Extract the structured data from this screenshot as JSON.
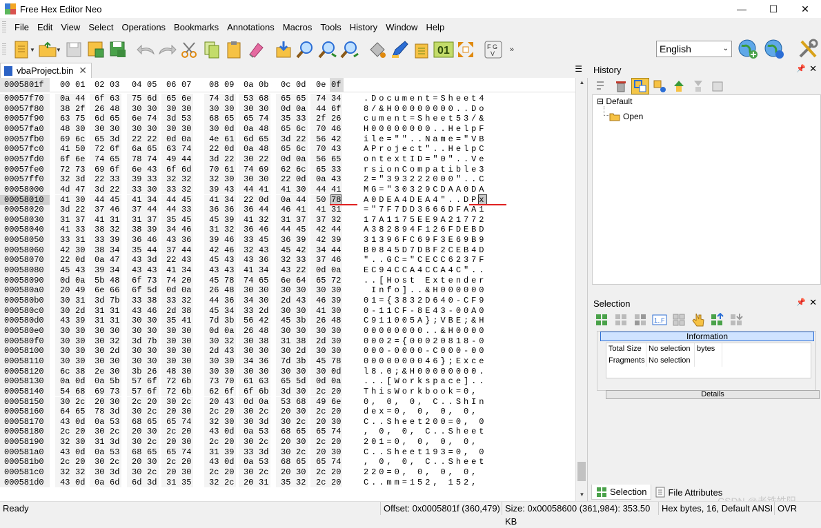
{
  "window": {
    "title": "Free Hex Editor Neo",
    "minimize": "—",
    "maximize": "☐",
    "close": "✕"
  },
  "menu": [
    "File",
    "Edit",
    "View",
    "Select",
    "Operations",
    "Bookmarks",
    "Annotations",
    "Macros",
    "Tools",
    "History",
    "Window",
    "Help"
  ],
  "toolbar": {
    "language": "English",
    "icons": [
      "new-file-icon",
      "open-folder-icon",
      "save-disk-icon",
      "save-as-icon",
      "save-all-icon",
      "undo-icon",
      "redo-icon",
      "cut-scissors-icon",
      "copy-icon",
      "paste-icon",
      "eraser-icon",
      "import-icon",
      "find-icon",
      "find-next-icon",
      "find-prev-icon",
      "fill-icon",
      "patch-icon",
      "annotate-icon",
      "binary-01-icon",
      "expand-icon",
      "fgv-icon",
      "globe-add-icon",
      "globe-icon",
      "settings-tools-icon"
    ]
  },
  "tab": {
    "label": "vbaProject.bin",
    "close": "✕",
    "menu_icon": "☰"
  },
  "hex": {
    "cursor_offset": "0005801f",
    "columns": [
      "00",
      "01",
      "02",
      "03",
      "04",
      "05",
      "06",
      "07",
      "08",
      "09",
      "0a",
      "0b",
      "0c",
      "0d",
      "0e",
      "0f"
    ],
    "rows": [
      {
        "off": "00057f70",
        "hex": "0a 44 6f 63 75 6d 65 6e 74 3d 53 68 65 65 74 34",
        "ascii": ".Document=Sheet4"
      },
      {
        "off": "00057f80",
        "hex": "38 2f 26 48 30 30 30 30 30 30 30 30 0d 0a 44 6f",
        "ascii": "8/&H00000000..Do"
      },
      {
        "off": "00057f90",
        "hex": "63 75 6d 65 6e 74 3d 53 68 65 65 74 35 33 2f 26",
        "ascii": "cument=Sheet53/&"
      },
      {
        "off": "00057fa0",
        "hex": "48 30 30 30 30 30 30 30 30 0d 0a 48 65 6c 70 46",
        "ascii": "H00000000..HelpF"
      },
      {
        "off": "00057fb0",
        "hex": "69 6c 65 3d 22 22 0d 0a 4e 61 6d 65 3d 22 56 42",
        "ascii": "ile=\"\"..Name=\"VB"
      },
      {
        "off": "00057fc0",
        "hex": "41 50 72 6f 6a 65 63 74 22 0d 0a 48 65 6c 70 43",
        "ascii": "AProject\"..HelpC"
      },
      {
        "off": "00057fd0",
        "hex": "6f 6e 74 65 78 74 49 44 3d 22 30 22 0d 0a 56 65",
        "ascii": "ontextID=\"0\"..Ve"
      },
      {
        "off": "00057fe0",
        "hex": "72 73 69 6f 6e 43 6f 6d 70 61 74 69 62 6c 65 33",
        "ascii": "rsionCompatible3"
      },
      {
        "off": "00057ff0",
        "hex": "32 3d 22 33 39 33 32 32 32 30 30 30 22 0d 0a 43",
        "ascii": "2=\"393222000\"..C"
      },
      {
        "off": "00058000",
        "hex": "4d 47 3d 22 33 30 33 32 39 43 44 41 41 30 44 41",
        "ascii": "MG=\"30329CDAA0DA"
      },
      {
        "off": "00058010",
        "hex": "41 30 44 45 41 34 44 45 41 34 22 0d 0a 44 50 78",
        "ascii": "A0DEA4DEA4\"..DPx"
      },
      {
        "off": "00058020",
        "hex": "3d 22 37 46 37 44 44 33 36 36 36 44 46 41 41 31",
        "ascii": "=\"7F7DD3666DFAA1"
      },
      {
        "off": "00058030",
        "hex": "31 37 41 31 31 37 35 45 45 39 41 32 31 37 37 32",
        "ascii": "17A1175EE9A21772"
      },
      {
        "off": "00058040",
        "hex": "41 33 38 32 38 39 34 46 31 32 36 46 44 45 42 44",
        "ascii": "A382894F126FDEBD"
      },
      {
        "off": "00058050",
        "hex": "33 31 33 39 36 46 43 36 39 46 33 45 36 39 42 39",
        "ascii": "31396FC69F3E69B9"
      },
      {
        "off": "00058060",
        "hex": "42 30 38 34 35 44 37 44 42 46 32 43 45 42 34 44",
        "ascii": "B0845D7DBF2CEB4D"
      },
      {
        "off": "00058070",
        "hex": "22 0d 0a 47 43 3d 22 43 45 43 43 36 32 33 37 46",
        "ascii": "\"..GC=\"CECC6237F"
      },
      {
        "off": "00058080",
        "hex": "45 43 39 34 43 43 41 34 43 43 41 34 43 22 0d 0a",
        "ascii": "EC94CCA4CCA4C\".."
      },
      {
        "off": "00058090",
        "hex": "0d 0a 5b 48 6f 73 74 20 45 78 74 65 6e 64 65 72",
        "ascii": "..[Host Extender"
      },
      {
        "off": "000580a0",
        "hex": "20 49 6e 66 6f 5d 0d 0a 26 48 30 30 30 30 30 30",
        "ascii": " Info]..&H000000"
      },
      {
        "off": "000580b0",
        "hex": "30 31 3d 7b 33 38 33 32 44 36 34 30 2d 43 46 39",
        "ascii": "01={3832D640-CF9"
      },
      {
        "off": "000580c0",
        "hex": "30 2d 31 31 43 46 2d 38 45 34 33 2d 30 30 41 30",
        "ascii": "0-11CF-8E43-00A0"
      },
      {
        "off": "000580d0",
        "hex": "43 39 31 31 30 30 35 41 7d 3b 56 42 45 3b 26 48",
        "ascii": "C911005A};VBE;&H"
      },
      {
        "off": "000580e0",
        "hex": "30 30 30 30 30 30 30 30 0d 0a 26 48 30 30 30 30",
        "ascii": "00000000..&H0000"
      },
      {
        "off": "000580f0",
        "hex": "30 30 30 32 3d 7b 30 30 30 32 30 38 31 38 2d 30",
        "ascii": "0002={00020818-0"
      },
      {
        "off": "00058100",
        "hex": "30 30 30 2d 30 30 30 30 2d 43 30 30 30 2d 30 30",
        "ascii": "000-0000-C000-00"
      },
      {
        "off": "00058110",
        "hex": "30 30 30 30 30 30 30 30 30 30 34 36 7d 3b 45 78",
        "ascii": "0000000046};Exce"
      },
      {
        "off": "00058120",
        "hex": "6c 38 2e 30 3b 26 48 30 30 30 30 30 30 30 30 0d",
        "ascii": "l8.0;&H00000000."
      },
      {
        "off": "00058130",
        "hex": "0a 0d 0a 5b 57 6f 72 6b 73 70 61 63 65 5d 0d 0a",
        "ascii": "...[Workspace].."
      },
      {
        "off": "00058140",
        "hex": "54 68 69 73 57 6f 72 6b 62 6f 6f 6b 3d 30 2c 20",
        "ascii": "ThisWorkbook=0, "
      },
      {
        "off": "00058150",
        "hex": "30 2c 20 30 2c 20 30 2c 20 43 0d 0a 53 68 49 6e",
        "ascii": "0, 0, 0, C..ShIn"
      },
      {
        "off": "00058160",
        "hex": "64 65 78 3d 30 2c 20 30 2c 20 30 2c 20 30 2c 20",
        "ascii": "dex=0, 0, 0, 0, "
      },
      {
        "off": "00058170",
        "hex": "43 0d 0a 53 68 65 65 74 32 30 30 3d 30 2c 20 30",
        "ascii": "C..Sheet200=0, 0"
      },
      {
        "off": "00058180",
        "hex": "2c 20 30 2c 20 30 2c 20 43 0d 0a 53 68 65 65 74",
        "ascii": ", 0, 0, C..Sheet"
      },
      {
        "off": "00058190",
        "hex": "32 30 31 3d 30 2c 20 30 2c 20 30 2c 20 30 2c 20",
        "ascii": "201=0, 0, 0, 0, "
      },
      {
        "off": "000581a0",
        "hex": "43 0d 0a 53 68 65 65 74 31 39 33 3d 30 2c 20 30",
        "ascii": "C..Sheet193=0, 0"
      },
      {
        "off": "000581b0",
        "hex": "2c 20 30 2c 20 30 2c 20 43 0d 0a 53 68 65 65 74",
        "ascii": ", 0, 0, C..Sheet"
      },
      {
        "off": "000581c0",
        "hex": "32 32 30 3d 30 2c 20 30 2c 20 30 2c 20 30 2c 20",
        "ascii": "220=0, 0, 0, 0, "
      },
      {
        "off": "000581d0",
        "hex": "43 0d 0a 6d 6d 3d 31 35 32 2c 20 31 35 32 2c 20",
        "ascii": "C..mm=152, 152, "
      }
    ]
  },
  "history": {
    "title": "History",
    "root": "Default",
    "items": [
      "Open"
    ]
  },
  "selection": {
    "title": "Selection",
    "info_title": "Information",
    "rows": [
      {
        "label": "Total Size",
        "value": "No selection",
        "unit": "bytes"
      },
      {
        "label": "Fragments",
        "value": "No selection",
        "unit": ""
      }
    ],
    "details": "Details"
  },
  "bottom_tabs": [
    "Selection",
    "File Attributes"
  ],
  "status": {
    "ready": "Ready",
    "offset": "Offset: 0x0005801f (360,479)",
    "size": "Size: 0x00058600 (361,984): 353.50 KB",
    "mode": "Hex bytes, 16, Default ANSI",
    "ovr": "OVR"
  },
  "watermark": "CSDN @老铁姓阳"
}
